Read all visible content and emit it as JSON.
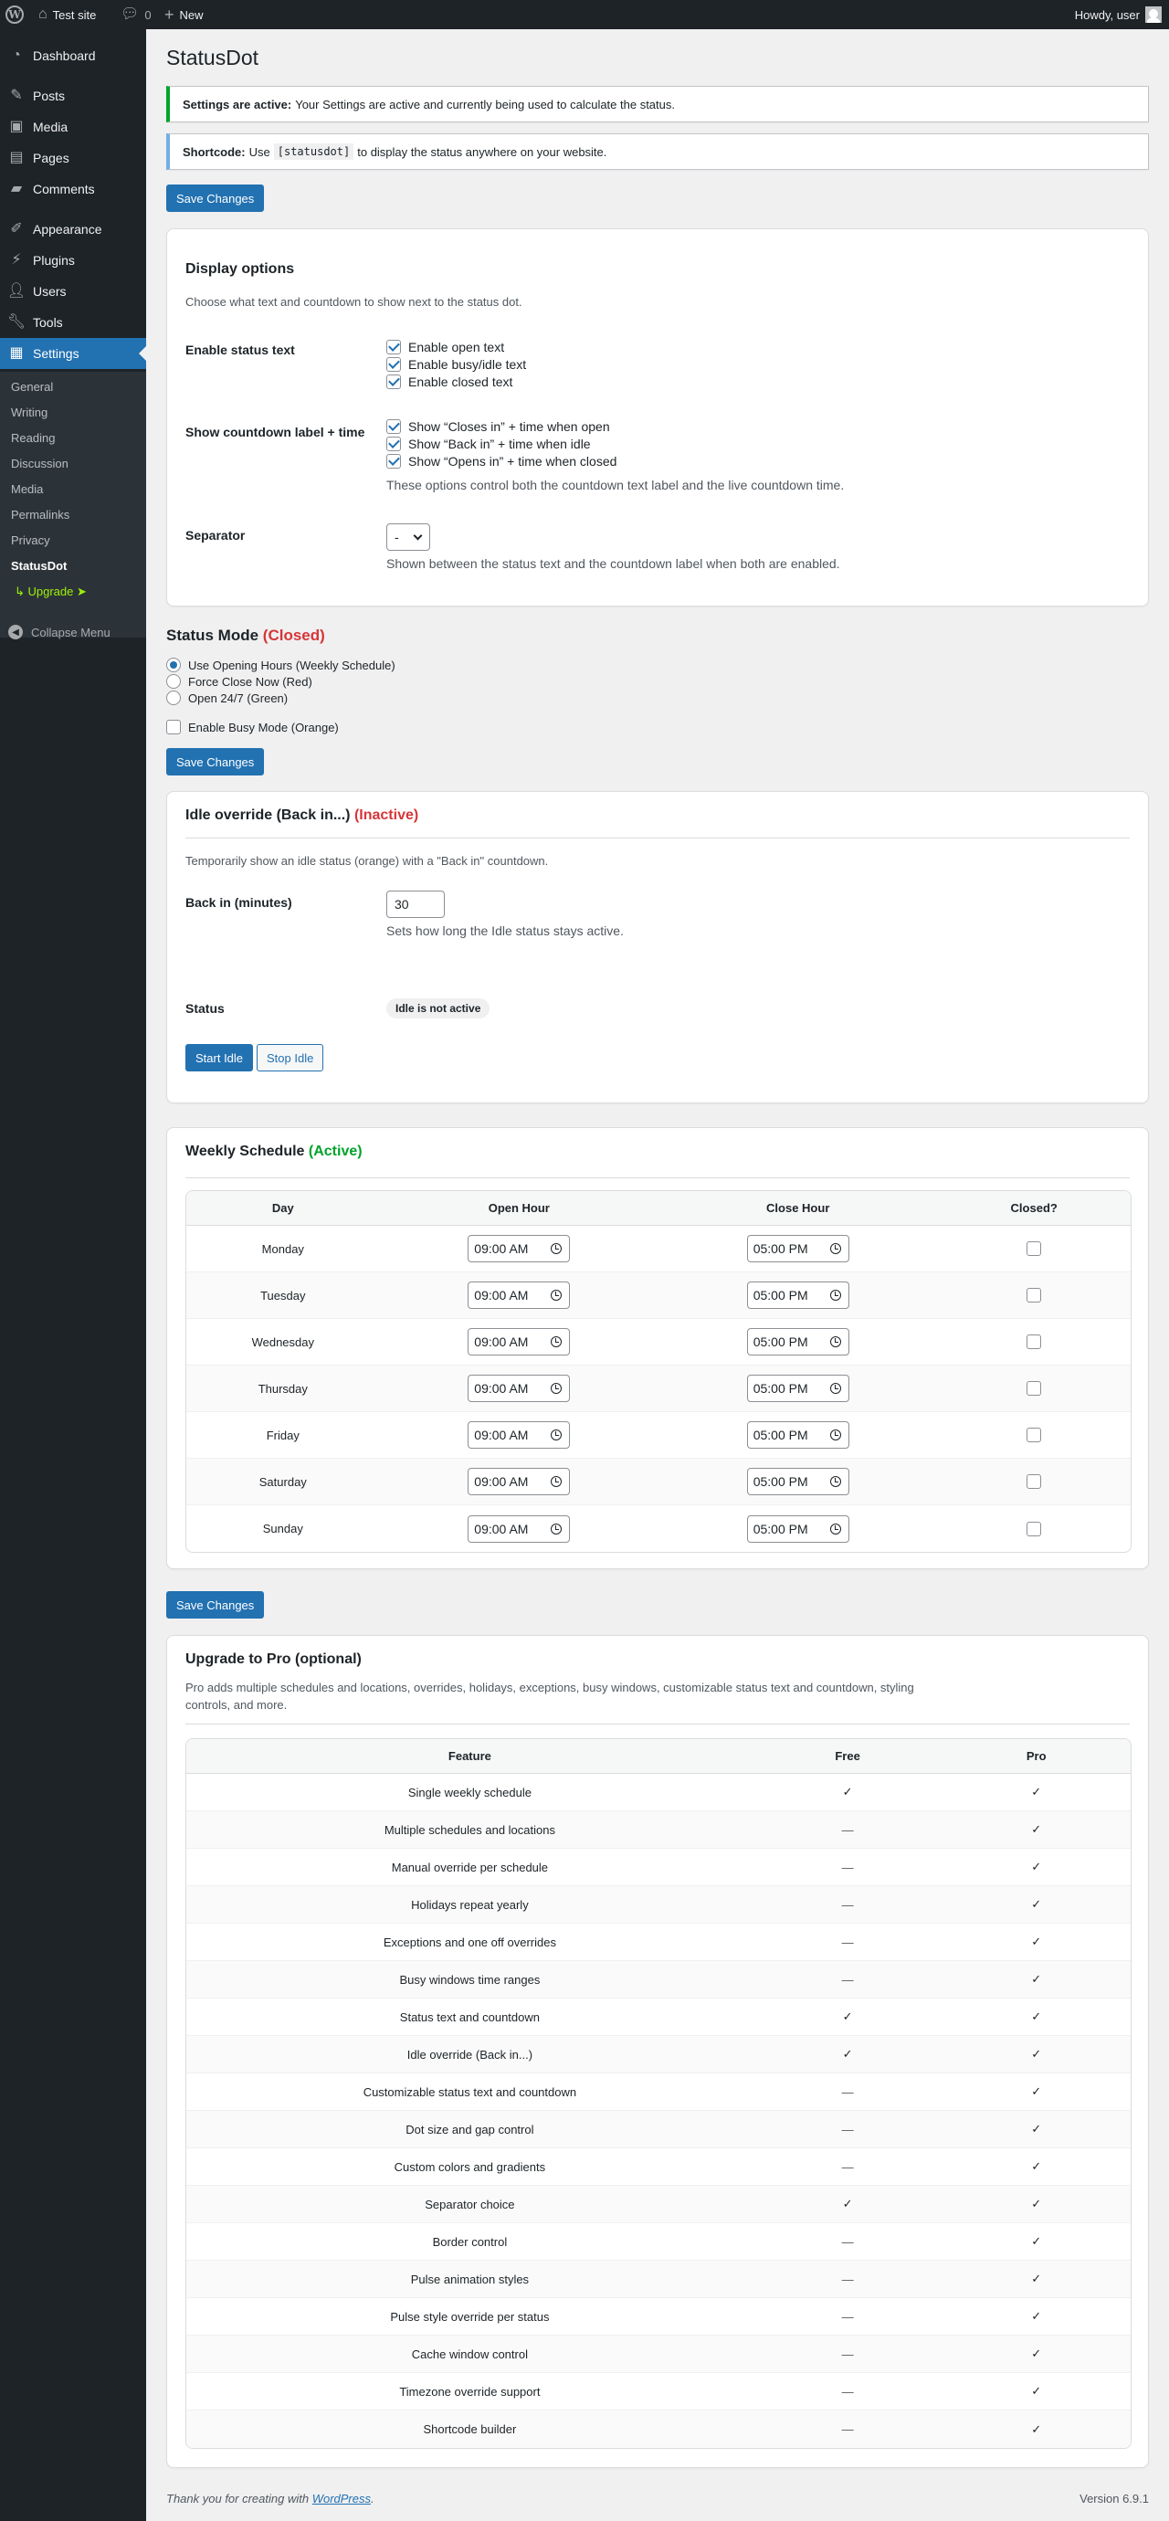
{
  "adminbar": {
    "site_name": "Test site",
    "comments_count": "0",
    "new_label": "New",
    "howdy": "Howdy, user"
  },
  "sidebar": {
    "items": [
      {
        "label": "Dashboard",
        "icon": "dashboard-icon"
      },
      {
        "label": "Posts",
        "icon": "pin-icon"
      },
      {
        "label": "Media",
        "icon": "media-icon"
      },
      {
        "label": "Pages",
        "icon": "page-icon"
      },
      {
        "label": "Comments",
        "icon": "comment-icon"
      },
      {
        "label": "Appearance",
        "icon": "brush-icon"
      },
      {
        "label": "Plugins",
        "icon": "plug-icon"
      },
      {
        "label": "Users",
        "icon": "user-icon"
      },
      {
        "label": "Tools",
        "icon": "wrench-icon"
      },
      {
        "label": "Settings",
        "icon": "settings-icon"
      }
    ],
    "submenu": [
      "General",
      "Writing",
      "Reading",
      "Discussion",
      "Media",
      "Permalinks",
      "Privacy",
      "StatusDot"
    ],
    "upgrade": "↳ Upgrade ➤",
    "collapse": "Collapse Menu"
  },
  "page": {
    "title": "StatusDot",
    "notice_active_bold": "Settings are active:",
    "notice_active_text": "Your Settings are active and currently being used to calculate the status.",
    "notice_shortcode_bold": "Shortcode:",
    "notice_shortcode_pre": "Use",
    "notice_shortcode_code": "[statusdot]",
    "notice_shortcode_post": "to display the status anywhere on your website.",
    "save_label": "Save Changes"
  },
  "display": {
    "title": "Display options",
    "desc": "Choose what text and countdown to show next to the status dot.",
    "status_text_label": "Enable status text",
    "status_text_options": [
      {
        "label": "Enable open text",
        "checked": true
      },
      {
        "label": "Enable busy/idle text",
        "checked": true
      },
      {
        "label": "Enable closed text",
        "checked": true
      }
    ],
    "countdown_label": "Show countdown label + time",
    "countdown_options": [
      {
        "label": "Show “Closes in” + time when open",
        "checked": true
      },
      {
        "label": "Show “Back in” + time when idle",
        "checked": true
      },
      {
        "label": "Show “Opens in” + time when closed",
        "checked": true
      }
    ],
    "countdown_help": "These options control both the countdown text label and the live countdown time.",
    "separator_label": "Separator",
    "separator_value": "-",
    "separator_help": "Shown between the status text and the countdown label when both are enabled."
  },
  "status_mode": {
    "title": "Status Mode",
    "state": "(Closed)",
    "options": [
      {
        "label": "Use Opening Hours (Weekly Schedule)",
        "checked": true
      },
      {
        "label": "Force Close Now (Red)",
        "checked": false
      },
      {
        "label": "Open 24/7 (Green)",
        "checked": false
      }
    ],
    "busy_label": "Enable Busy Mode (Orange)",
    "busy_checked": false
  },
  "idle": {
    "title": "Idle override (Back in...)",
    "state": "(Inactive)",
    "desc": "Temporarily show an idle status (orange) with a \"Back in\" countdown.",
    "back_in_label": "Back in (minutes)",
    "back_in_value": "30",
    "back_in_help": "Sets how long the Idle status stays active.",
    "status_label": "Status",
    "status_badge": "Idle is not active",
    "start_label": "Start Idle",
    "stop_label": "Stop Idle"
  },
  "schedule": {
    "title": "Weekly Schedule",
    "state": "(Active)",
    "headers": [
      "Day",
      "Open Hour",
      "Close Hour",
      "Closed?"
    ],
    "rows": [
      {
        "day": "Monday",
        "open": "09:00 AM",
        "close": "05:00 PM",
        "closed": false
      },
      {
        "day": "Tuesday",
        "open": "09:00 AM",
        "close": "05:00 PM",
        "closed": false
      },
      {
        "day": "Wednesday",
        "open": "09:00 AM",
        "close": "05:00 PM",
        "closed": false
      },
      {
        "day": "Thursday",
        "open": "09:00 AM",
        "close": "05:00 PM",
        "closed": false
      },
      {
        "day": "Friday",
        "open": "09:00 AM",
        "close": "05:00 PM",
        "closed": false
      },
      {
        "day": "Saturday",
        "open": "09:00 AM",
        "close": "05:00 PM",
        "closed": false
      },
      {
        "day": "Sunday",
        "open": "09:00 AM",
        "close": "05:00 PM",
        "closed": false
      }
    ]
  },
  "pro": {
    "title": "Upgrade to Pro (optional)",
    "desc_line1": "Pro adds multiple schedules and locations, overrides, holidays, exceptions, busy windows, customizable status text and countdown, styling",
    "desc_line2": "controls, and more.",
    "headers": [
      "Feature",
      "Free",
      "Pro"
    ],
    "rows": [
      {
        "feature": "Single weekly schedule",
        "free": "✓",
        "pro": "✓"
      },
      {
        "feature": "Multiple schedules and locations",
        "free": "—",
        "pro": "✓"
      },
      {
        "feature": "Manual override per schedule",
        "free": "—",
        "pro": "✓"
      },
      {
        "feature": "Holidays repeat yearly",
        "free": "—",
        "pro": "✓"
      },
      {
        "feature": "Exceptions and one off overrides",
        "free": "—",
        "pro": "✓"
      },
      {
        "feature": "Busy windows time ranges",
        "free": "—",
        "pro": "✓"
      },
      {
        "feature": "Status text and countdown",
        "free": "✓",
        "pro": "✓"
      },
      {
        "feature": "Idle override (Back in...)",
        "free": "✓",
        "pro": "✓"
      },
      {
        "feature": "Customizable status text and countdown",
        "free": "—",
        "pro": "✓"
      },
      {
        "feature": "Dot size and gap control",
        "free": "—",
        "pro": "✓"
      },
      {
        "feature": "Custom colors and gradients",
        "free": "—",
        "pro": "✓"
      },
      {
        "feature": "Separator choice",
        "free": "✓",
        "pro": "✓"
      },
      {
        "feature": "Border control",
        "free": "—",
        "pro": "✓"
      },
      {
        "feature": "Pulse animation styles",
        "free": "—",
        "pro": "✓"
      },
      {
        "feature": "Pulse style override per status",
        "free": "—",
        "pro": "✓"
      },
      {
        "feature": "Cache window control",
        "free": "—",
        "pro": "✓"
      },
      {
        "feature": "Timezone override support",
        "free": "—",
        "pro": "✓"
      },
      {
        "feature": "Shortcode builder",
        "free": "—",
        "pro": "✓"
      }
    ]
  },
  "footer": {
    "thanks_pre": "Thank you for creating with",
    "thanks_link": "WordPress",
    "thanks_post": ".",
    "version": "Version 6.9.1"
  },
  "colors": {
    "accent": "#2271b1",
    "closed_red": "#d63638",
    "active_green": "#00a32a",
    "upgrade_green": "#9ef10b",
    "admin_dark": "#1d2327"
  }
}
